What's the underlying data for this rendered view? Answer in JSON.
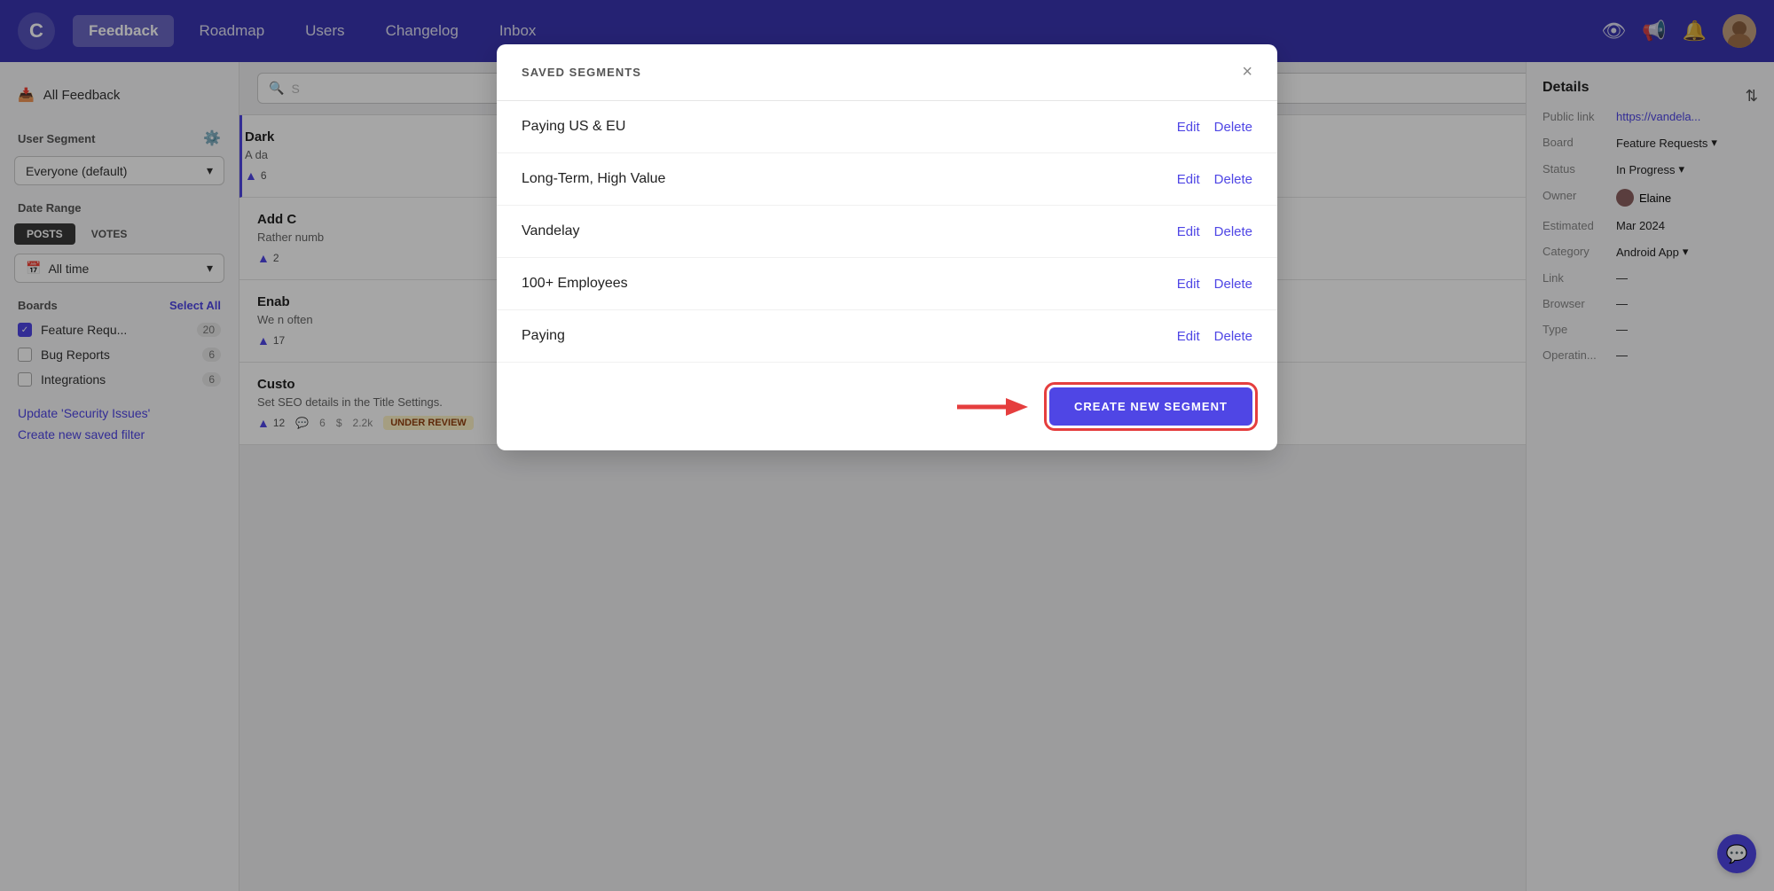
{
  "nav": {
    "logo": "C",
    "items": [
      {
        "label": "Feedback",
        "active": true
      },
      {
        "label": "Roadmap",
        "active": false
      },
      {
        "label": "Users",
        "active": false
      },
      {
        "label": "Changelog",
        "active": false
      },
      {
        "label": "Inbox",
        "active": false
      }
    ],
    "icons": [
      "eye",
      "megaphone",
      "bell"
    ],
    "avatar_alt": "User avatar"
  },
  "sidebar": {
    "all_feedback_label": "All Feedback",
    "user_segment_label": "User Segment",
    "user_segment_value": "Everyone (default)",
    "date_range_label": "Date Range",
    "date_tabs": [
      {
        "label": "POSTS",
        "active": true
      },
      {
        "label": "VOTES",
        "active": false
      }
    ],
    "date_all_time": "All time",
    "boards_label": "Boards",
    "select_all_label": "Select All",
    "boards": [
      {
        "label": "Feature Requ...",
        "checked": true,
        "count": "20"
      },
      {
        "label": "Bug Reports",
        "checked": false,
        "count": "6"
      },
      {
        "label": "Integrations",
        "checked": false,
        "count": "6"
      }
    ],
    "links": [
      {
        "label": "Update 'Security Issues'"
      },
      {
        "label": "Create new saved filter"
      }
    ]
  },
  "posts": [
    {
      "title": "Dark",
      "excerpt": "A da",
      "votes": "6",
      "comments": "",
      "revenue": "",
      "status": ""
    },
    {
      "title": "Add C",
      "excerpt": "Rather numb",
      "votes": "2",
      "comments": "",
      "revenue": "",
      "status": ""
    },
    {
      "title": "Enab",
      "excerpt": "We n often",
      "votes": "17",
      "comments": "",
      "revenue": "",
      "status": ""
    },
    {
      "title": "Custo",
      "excerpt": "Set SEO details in the Title Settings.",
      "votes": "12",
      "comments": "6",
      "revenue": "2.2k",
      "status": "UNDER REVIEW"
    }
  ],
  "details": {
    "title": "Details",
    "public_link_label": "Public link",
    "public_link_value": "https://vandela...",
    "board_label": "Board",
    "board_value": "Feature Requests",
    "status_label": "Status",
    "status_value": "In Progress",
    "owner_label": "Owner",
    "owner_value": "Elaine",
    "estimated_label": "Estimated",
    "estimated_value": "Mar 2024",
    "category_label": "Category",
    "category_value": "Android App",
    "link_label": "Link",
    "link_value": "—",
    "browser_label": "Browser",
    "browser_value": "—",
    "type_label": "Type",
    "type_value": "—",
    "operating_label": "Operatin...",
    "operating_value": "—"
  },
  "modal": {
    "title": "SAVED SEGMENTS",
    "close_label": "×",
    "segments": [
      {
        "name": "Paying US & EU"
      },
      {
        "name": "Long-Term, High Value"
      },
      {
        "name": "Vandelay"
      },
      {
        "name": "100+ Employees"
      },
      {
        "name": "Paying"
      }
    ],
    "edit_label": "Edit",
    "delete_label": "Delete",
    "create_button_label": "CREATE NEW SEGMENT"
  },
  "chat_icon": "💬"
}
